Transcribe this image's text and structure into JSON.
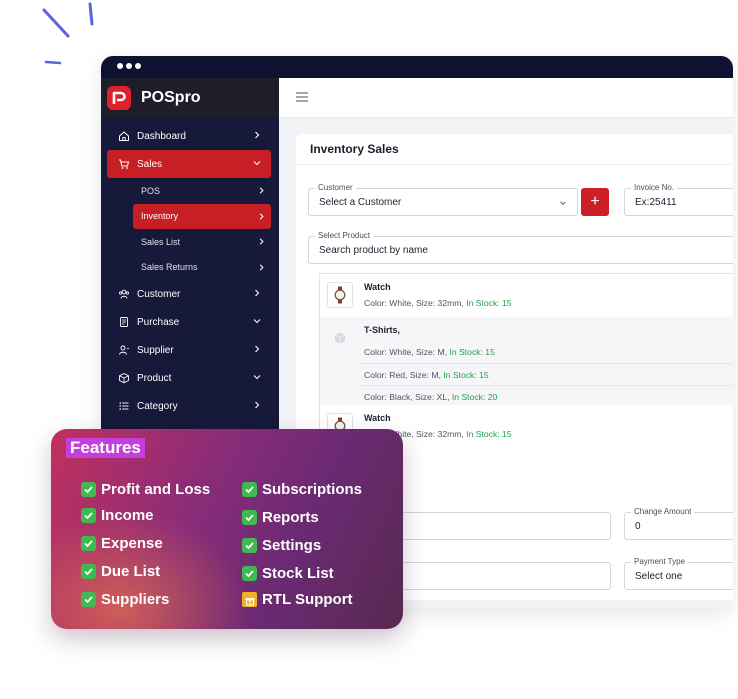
{
  "app": {
    "brand_name": "POSpro",
    "accent_color": "#c81e25",
    "sidebar_color": "#16193a"
  },
  "sidebar": {
    "items": [
      {
        "label": "Dashboard",
        "icon": "home-icon"
      },
      {
        "label": "Sales",
        "icon": "cart-icon",
        "active": true,
        "expanded": true
      },
      {
        "label": "Customer",
        "icon": "users-icon"
      },
      {
        "label": "Purchase",
        "icon": "receipt-icon"
      },
      {
        "label": "Supplier",
        "icon": "supplier-icon"
      },
      {
        "label": "Product",
        "icon": "box-icon"
      },
      {
        "label": "Category",
        "icon": "list-icon"
      }
    ],
    "sales_sub": [
      {
        "label": "POS"
      },
      {
        "label": "Inventory",
        "active": true
      },
      {
        "label": "Sales List"
      },
      {
        "label": "Sales Returns"
      }
    ]
  },
  "page": {
    "title": "Inventory Sales",
    "customer": {
      "legend": "Customer",
      "value": "Select a Customer",
      "add_label": "+"
    },
    "invoice": {
      "legend": "Invoice No.",
      "value": "Ex:25411"
    },
    "select_product": {
      "legend": "Select Product",
      "placeholder": "Search product by name"
    },
    "products": [
      {
        "name": "Watch",
        "variants": [
          {
            "text": "Color: White, Size: 32mm, ",
            "stock": "In Stock: 15"
          }
        ]
      },
      {
        "name": "T-Shirts,",
        "variants": [
          {
            "text": "Color: White, Size: M, ",
            "stock": "In Stock: 15"
          },
          {
            "text": "Color: Red, Size: M, ",
            "stock": "In Stock: 15"
          },
          {
            "text": "Color: Black, Size: XL, ",
            "stock": "In Stock: 20"
          }
        ]
      },
      {
        "name": "Watch",
        "variants": [
          {
            "text": "Color: White, Size: 32mm, ",
            "stock": "In Stock: 15"
          }
        ]
      }
    ],
    "change_amount": {
      "legend": "Change Amount",
      "value": "0"
    },
    "payment_type": {
      "legend": "Payment Type",
      "value": "Select one"
    }
  },
  "features": {
    "title": "Features",
    "left": [
      "Profit and Loss",
      "Income",
      "Expense",
      "Due List",
      "Suppliers"
    ],
    "right": [
      "Subscriptions",
      "Reports",
      "Settings",
      "Stock List",
      "RTL Support"
    ]
  }
}
